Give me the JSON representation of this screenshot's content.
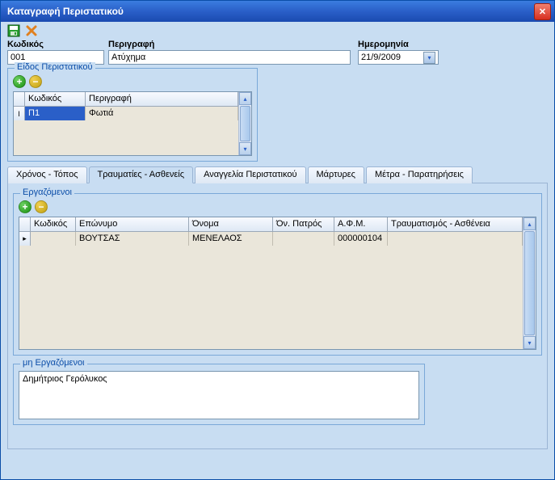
{
  "window": {
    "title": "Καταγραφή Περιστατικού"
  },
  "fields": {
    "code_label": "Κωδικός",
    "code_value": "001",
    "desc_label": "Περιγραφή",
    "desc_value": "Ατύχημα",
    "date_label": "Ημερομηνία",
    "date_value": "21/9/2009"
  },
  "incident_type": {
    "title": "Είδος Περιστατικού",
    "columns": {
      "code": "Κωδικός",
      "desc": "Περιγραφή"
    },
    "rows": [
      {
        "code": "Π1",
        "desc": "Φωτιά"
      }
    ]
  },
  "tabs": {
    "t1": "Χρόνος - Τόπος",
    "t2": "Τραυματίες - Ασθενείς",
    "t3": "Αναγγελία Περιστατικού",
    "t4": "Μάρτυρες",
    "t5": "Μέτρα - Παρατηρήσεις"
  },
  "employees": {
    "title": "Εργαζόμενοι",
    "columns": {
      "code": "Κωδικός",
      "surname": "Επώνυμο",
      "name": "Όνομα",
      "father": "Όν. Πατρός",
      "afm": "Α.Φ.Μ.",
      "injury": "Τραυματισμός - Ασθένεια"
    },
    "rows": [
      {
        "code": "",
        "surname": "ΒΟΥΤΣΑΣ",
        "name": "ΜΕΝΕΛΑΟΣ",
        "father": "",
        "afm": "000000104",
        "injury": ""
      }
    ]
  },
  "non_employees": {
    "title": "μη Εργαζόμενοι",
    "value": "Δημήτριος Γερόλυκος"
  }
}
